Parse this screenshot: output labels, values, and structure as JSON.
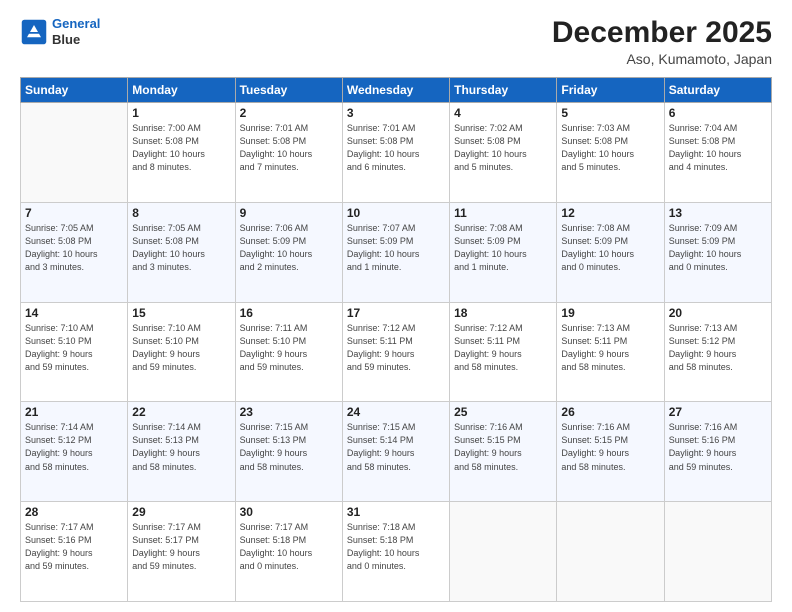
{
  "header": {
    "logo_line1": "General",
    "logo_line2": "Blue",
    "title": "December 2025",
    "subtitle": "Aso, Kumamoto, Japan"
  },
  "days_of_week": [
    "Sunday",
    "Monday",
    "Tuesday",
    "Wednesday",
    "Thursday",
    "Friday",
    "Saturday"
  ],
  "weeks": [
    [
      {
        "day": "",
        "info": ""
      },
      {
        "day": "1",
        "info": "Sunrise: 7:00 AM\nSunset: 5:08 PM\nDaylight: 10 hours\nand 8 minutes."
      },
      {
        "day": "2",
        "info": "Sunrise: 7:01 AM\nSunset: 5:08 PM\nDaylight: 10 hours\nand 7 minutes."
      },
      {
        "day": "3",
        "info": "Sunrise: 7:01 AM\nSunset: 5:08 PM\nDaylight: 10 hours\nand 6 minutes."
      },
      {
        "day": "4",
        "info": "Sunrise: 7:02 AM\nSunset: 5:08 PM\nDaylight: 10 hours\nand 5 minutes."
      },
      {
        "day": "5",
        "info": "Sunrise: 7:03 AM\nSunset: 5:08 PM\nDaylight: 10 hours\nand 5 minutes."
      },
      {
        "day": "6",
        "info": "Sunrise: 7:04 AM\nSunset: 5:08 PM\nDaylight: 10 hours\nand 4 minutes."
      }
    ],
    [
      {
        "day": "7",
        "info": "Sunrise: 7:05 AM\nSunset: 5:08 PM\nDaylight: 10 hours\nand 3 minutes."
      },
      {
        "day": "8",
        "info": "Sunrise: 7:05 AM\nSunset: 5:08 PM\nDaylight: 10 hours\nand 3 minutes."
      },
      {
        "day": "9",
        "info": "Sunrise: 7:06 AM\nSunset: 5:09 PM\nDaylight: 10 hours\nand 2 minutes."
      },
      {
        "day": "10",
        "info": "Sunrise: 7:07 AM\nSunset: 5:09 PM\nDaylight: 10 hours\nand 1 minute."
      },
      {
        "day": "11",
        "info": "Sunrise: 7:08 AM\nSunset: 5:09 PM\nDaylight: 10 hours\nand 1 minute."
      },
      {
        "day": "12",
        "info": "Sunrise: 7:08 AM\nSunset: 5:09 PM\nDaylight: 10 hours\nand 0 minutes."
      },
      {
        "day": "13",
        "info": "Sunrise: 7:09 AM\nSunset: 5:09 PM\nDaylight: 10 hours\nand 0 minutes."
      }
    ],
    [
      {
        "day": "14",
        "info": "Sunrise: 7:10 AM\nSunset: 5:10 PM\nDaylight: 9 hours\nand 59 minutes."
      },
      {
        "day": "15",
        "info": "Sunrise: 7:10 AM\nSunset: 5:10 PM\nDaylight: 9 hours\nand 59 minutes."
      },
      {
        "day": "16",
        "info": "Sunrise: 7:11 AM\nSunset: 5:10 PM\nDaylight: 9 hours\nand 59 minutes."
      },
      {
        "day": "17",
        "info": "Sunrise: 7:12 AM\nSunset: 5:11 PM\nDaylight: 9 hours\nand 59 minutes."
      },
      {
        "day": "18",
        "info": "Sunrise: 7:12 AM\nSunset: 5:11 PM\nDaylight: 9 hours\nand 58 minutes."
      },
      {
        "day": "19",
        "info": "Sunrise: 7:13 AM\nSunset: 5:11 PM\nDaylight: 9 hours\nand 58 minutes."
      },
      {
        "day": "20",
        "info": "Sunrise: 7:13 AM\nSunset: 5:12 PM\nDaylight: 9 hours\nand 58 minutes."
      }
    ],
    [
      {
        "day": "21",
        "info": "Sunrise: 7:14 AM\nSunset: 5:12 PM\nDaylight: 9 hours\nand 58 minutes."
      },
      {
        "day": "22",
        "info": "Sunrise: 7:14 AM\nSunset: 5:13 PM\nDaylight: 9 hours\nand 58 minutes."
      },
      {
        "day": "23",
        "info": "Sunrise: 7:15 AM\nSunset: 5:13 PM\nDaylight: 9 hours\nand 58 minutes."
      },
      {
        "day": "24",
        "info": "Sunrise: 7:15 AM\nSunset: 5:14 PM\nDaylight: 9 hours\nand 58 minutes."
      },
      {
        "day": "25",
        "info": "Sunrise: 7:16 AM\nSunset: 5:15 PM\nDaylight: 9 hours\nand 58 minutes."
      },
      {
        "day": "26",
        "info": "Sunrise: 7:16 AM\nSunset: 5:15 PM\nDaylight: 9 hours\nand 58 minutes."
      },
      {
        "day": "27",
        "info": "Sunrise: 7:16 AM\nSunset: 5:16 PM\nDaylight: 9 hours\nand 59 minutes."
      }
    ],
    [
      {
        "day": "28",
        "info": "Sunrise: 7:17 AM\nSunset: 5:16 PM\nDaylight: 9 hours\nand 59 minutes."
      },
      {
        "day": "29",
        "info": "Sunrise: 7:17 AM\nSunset: 5:17 PM\nDaylight: 9 hours\nand 59 minutes."
      },
      {
        "day": "30",
        "info": "Sunrise: 7:17 AM\nSunset: 5:18 PM\nDaylight: 10 hours\nand 0 minutes."
      },
      {
        "day": "31",
        "info": "Sunrise: 7:18 AM\nSunset: 5:18 PM\nDaylight: 10 hours\nand 0 minutes."
      },
      {
        "day": "",
        "info": ""
      },
      {
        "day": "",
        "info": ""
      },
      {
        "day": "",
        "info": ""
      }
    ]
  ]
}
